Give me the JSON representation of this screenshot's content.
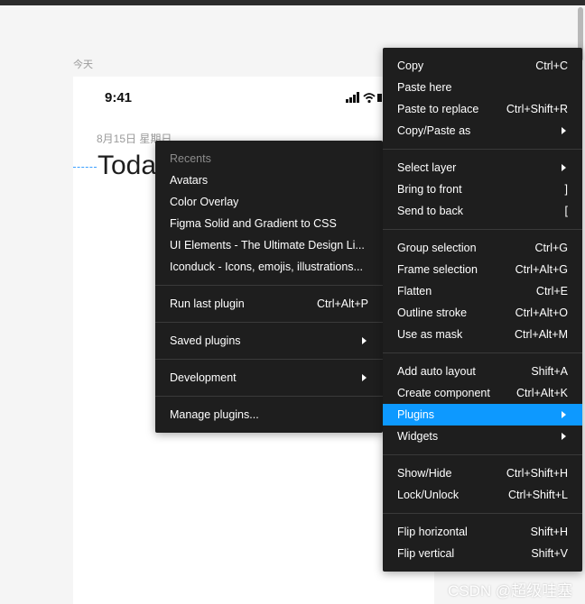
{
  "canvas": {
    "frame_label": "今天",
    "status_time": "9:41",
    "date_text": "8月15日 星期日",
    "title": "Today"
  },
  "plugins_menu": {
    "recents_header": "Recents",
    "recents": [
      "Avatars",
      "Color Overlay",
      "Figma Solid and Gradient to CSS",
      "UI Elements - The Ultimate Design Li...",
      "Iconduck - Icons, emojis, illustrations..."
    ],
    "run_last": {
      "label": "Run last plugin",
      "shortcut": "Ctrl+Alt+P"
    },
    "saved_plugins": "Saved plugins",
    "development": "Development",
    "manage": "Manage plugins..."
  },
  "context_menu": {
    "copy": {
      "label": "Copy",
      "shortcut": "Ctrl+C"
    },
    "paste_here": {
      "label": "Paste here",
      "shortcut": ""
    },
    "paste_replace": {
      "label": "Paste to replace",
      "shortcut": "Ctrl+Shift+R"
    },
    "copy_paste_as": {
      "label": "Copy/Paste as"
    },
    "select_layer": {
      "label": "Select layer"
    },
    "bring_front": {
      "label": "Bring to front",
      "shortcut": "]"
    },
    "send_back": {
      "label": "Send to back",
      "shortcut": "["
    },
    "group": {
      "label": "Group selection",
      "shortcut": "Ctrl+G"
    },
    "frame": {
      "label": "Frame selection",
      "shortcut": "Ctrl+Alt+G"
    },
    "flatten": {
      "label": "Flatten",
      "shortcut": "Ctrl+E"
    },
    "outline": {
      "label": "Outline stroke",
      "shortcut": "Ctrl+Alt+O"
    },
    "mask": {
      "label": "Use as mask",
      "shortcut": "Ctrl+Alt+M"
    },
    "auto_layout": {
      "label": "Add auto layout",
      "shortcut": "Shift+A"
    },
    "component": {
      "label": "Create component",
      "shortcut": "Ctrl+Alt+K"
    },
    "plugins": {
      "label": "Plugins"
    },
    "widgets": {
      "label": "Widgets"
    },
    "show_hide": {
      "label": "Show/Hide",
      "shortcut": "Ctrl+Shift+H"
    },
    "lock": {
      "label": "Lock/Unlock",
      "shortcut": "Ctrl+Shift+L"
    },
    "flip_h": {
      "label": "Flip horizontal",
      "shortcut": "Shift+H"
    },
    "flip_v": {
      "label": "Flip vertical",
      "shortcut": "Shift+V"
    }
  },
  "watermark": "CSDN @超级哇塞",
  "colors": {
    "menu_bg": "#1e1e1e",
    "highlight": "#0d99ff",
    "canvas_bg": "#f5f5f5"
  }
}
